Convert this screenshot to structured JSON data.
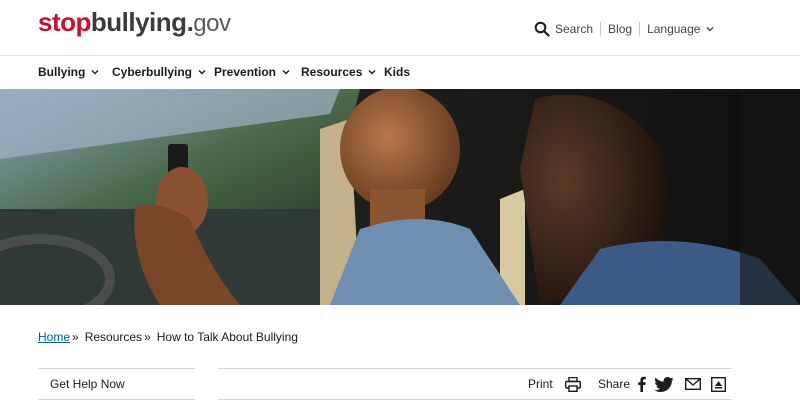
{
  "logo": {
    "part1": "stop",
    "part2": "bullying",
    "dot": ".",
    "part3": "gov"
  },
  "utility": {
    "search_label": "Search",
    "blog_label": "Blog",
    "language_label": "Language"
  },
  "nav": {
    "items": [
      {
        "label": "Bullying",
        "has_dropdown": true
      },
      {
        "label": "Cyberbullying",
        "has_dropdown": true
      },
      {
        "label": "Prevention",
        "has_dropdown": true
      },
      {
        "label": "Resources",
        "has_dropdown": true
      },
      {
        "label": "Kids",
        "has_dropdown": false
      }
    ]
  },
  "hero": {
    "icon": "hero-photo"
  },
  "breadcrumb": {
    "items": [
      "Home",
      "Resources",
      "How to Talk About Bullying"
    ],
    "separator": "»"
  },
  "sidebar": {
    "get_help_label": "Get Help Now"
  },
  "toolbar": {
    "print_label": "Print",
    "share_label": "Share"
  },
  "colors": {
    "brand_red": "#c41230",
    "link_blue": "#005ea2",
    "text": "#1b1b1b"
  }
}
